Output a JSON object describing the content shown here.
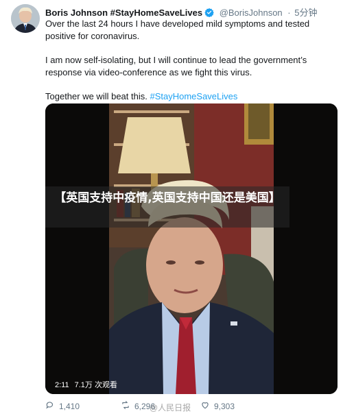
{
  "tweet": {
    "author_name": "Boris Johnson",
    "author_hashtag": "#StayHomeSaveLives",
    "handle": "@BorisJohnson",
    "separator": "·",
    "time": "5分钟",
    "paragraph1": "Over the last 24 hours I have developed mild symptoms and tested positive for coronavirus.",
    "paragraph2": "I am now self-isolating, but I will continue to lead the government’s response via video-conference as we fight this virus.",
    "paragraph3_text": "Together we will beat this.",
    "paragraph3_hashtag": "#StayHomeSaveLives"
  },
  "overlay": {
    "title": "【英国支持中疫情,英国支持中国还是美国】"
  },
  "video": {
    "duration": "2:11",
    "views": "7.1万 次观看"
  },
  "actions": {
    "replies": "1,410",
    "retweets": "6,296",
    "likes": "9,303"
  },
  "watermark": {
    "text": "@人民日报"
  },
  "colors": {
    "hashtag": "#1da1f2",
    "verified": "#1da1f2",
    "secondary_text": "#657786"
  }
}
